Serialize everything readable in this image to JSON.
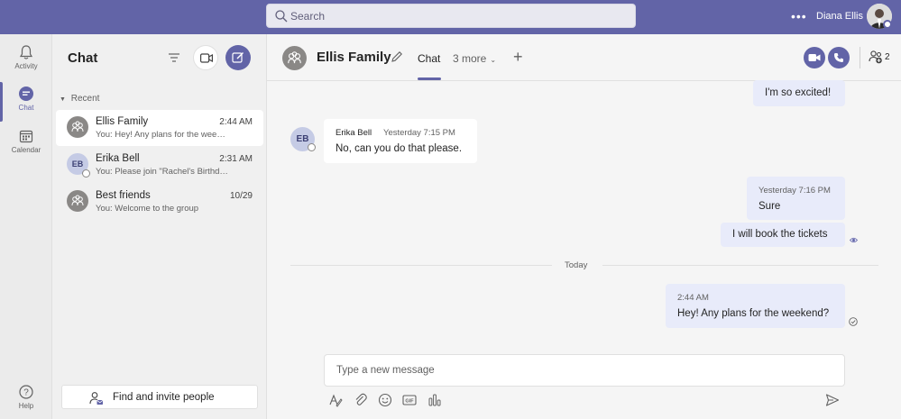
{
  "search": {
    "placeholder": "Search"
  },
  "user": {
    "name": "Diana Ellis",
    "more_label": "•••"
  },
  "rail": {
    "items": [
      {
        "label": "Activity",
        "icon": "bell-icon"
      },
      {
        "label": "Chat",
        "icon": "chat-icon"
      },
      {
        "label": "Calendar",
        "icon": "calendar-icon"
      }
    ],
    "help_label": "Help"
  },
  "chat_list": {
    "title": "Chat",
    "section": "Recent",
    "items": [
      {
        "name": "Ellis Family",
        "time": "2:44 AM",
        "preview": "You: Hey! Any plans for the wee…",
        "avatar": "group-icon"
      },
      {
        "name": "Erika Bell",
        "time": "2:31 AM",
        "preview": "You: Please join \"Rachel's Birthd…",
        "initials": "EB"
      },
      {
        "name": "Best friends",
        "time": "10/29",
        "preview": "You: Welcome to the group",
        "avatar": "group-icon"
      }
    ],
    "invite_label": "Find and invite people"
  },
  "conversation": {
    "title": "Ellis Family",
    "tab_active": "Chat",
    "tab_more": "3 more",
    "participants_count": "2",
    "messages": [
      {
        "body": "I'm so excited!"
      },
      {
        "sender": "Erika Bell",
        "time": "Yesterday 7:15 PM",
        "body": "No, can you do that please.",
        "initials": "EB"
      },
      {
        "time": "Yesterday 7:16 PM",
        "body": "Sure"
      },
      {
        "body": "I will book the tickets"
      },
      {
        "time": "2:44 AM",
        "body": "Hey! Any plans for the weekend?"
      }
    ],
    "divider_label": "Today"
  },
  "compose": {
    "placeholder": "Type a new message"
  },
  "colors": {
    "accent": "#6264a7",
    "mine_bubble": "#e8ebfa"
  }
}
